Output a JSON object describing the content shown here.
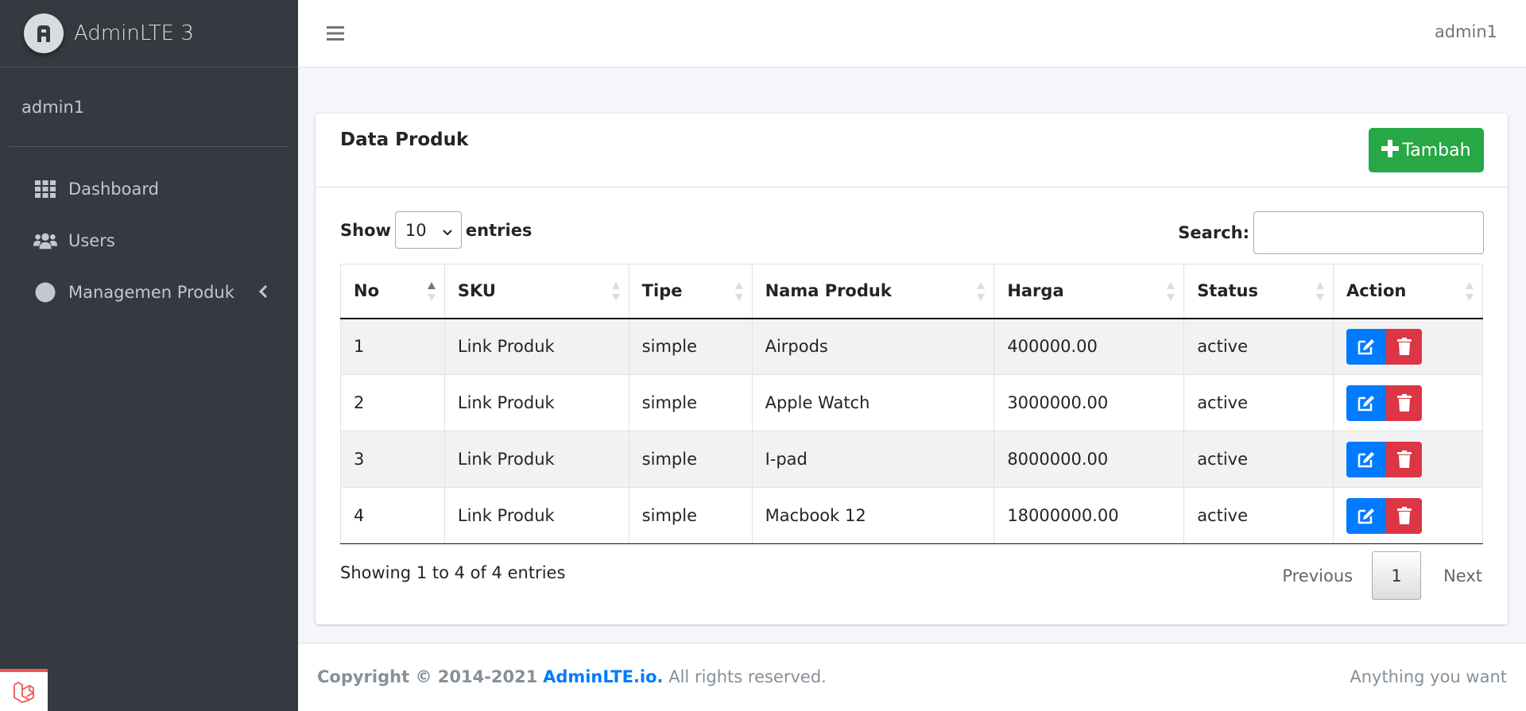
{
  "brand": {
    "name": "AdminLTE 3"
  },
  "sidebar": {
    "user": "admin1",
    "items": [
      {
        "label": "Dashboard",
        "icon": "grid-icon"
      },
      {
        "label": "Users",
        "icon": "users-icon"
      },
      {
        "label": "Managemen Produk",
        "icon": "circle-icon"
      }
    ]
  },
  "navbar": {
    "user": "admin1"
  },
  "card": {
    "title": "Data Produk",
    "add_label": "Tambah",
    "show_label": "Show",
    "show_value": "10",
    "entries_label": "entries",
    "search_label": "Search:",
    "search_value": ""
  },
  "table": {
    "columns": [
      "No",
      "SKU",
      "Tipe",
      "Nama Produk",
      "Harga",
      "Status",
      "Action"
    ],
    "rows": [
      {
        "no": "1",
        "sku": "Link Produk",
        "tipe": "simple",
        "nama": "Airpods",
        "harga": "400000.00",
        "status": "active"
      },
      {
        "no": "2",
        "sku": "Link Produk",
        "tipe": "simple",
        "nama": "Apple Watch",
        "harga": "3000000.00",
        "status": "active"
      },
      {
        "no": "3",
        "sku": "Link Produk",
        "tipe": "simple",
        "nama": "I-pad",
        "harga": "8000000.00",
        "status": "active"
      },
      {
        "no": "4",
        "sku": "Link Produk",
        "tipe": "simple",
        "nama": "Macbook 12",
        "harga": "18000000.00",
        "status": "active"
      }
    ]
  },
  "pagination": {
    "info": "Showing 1 to 4 of 4 entries",
    "previous": "Previous",
    "page": "1",
    "next": "Next"
  },
  "footer": {
    "copyright": "Copyright © 2014-2021",
    "link": "AdminLTE.io.",
    "rights": "All rights reserved.",
    "right_text": "Anything you want"
  },
  "colors": {
    "sidebar": "#343a40",
    "primary": "#007bff",
    "success": "#28a745",
    "danger": "#dc3545"
  }
}
